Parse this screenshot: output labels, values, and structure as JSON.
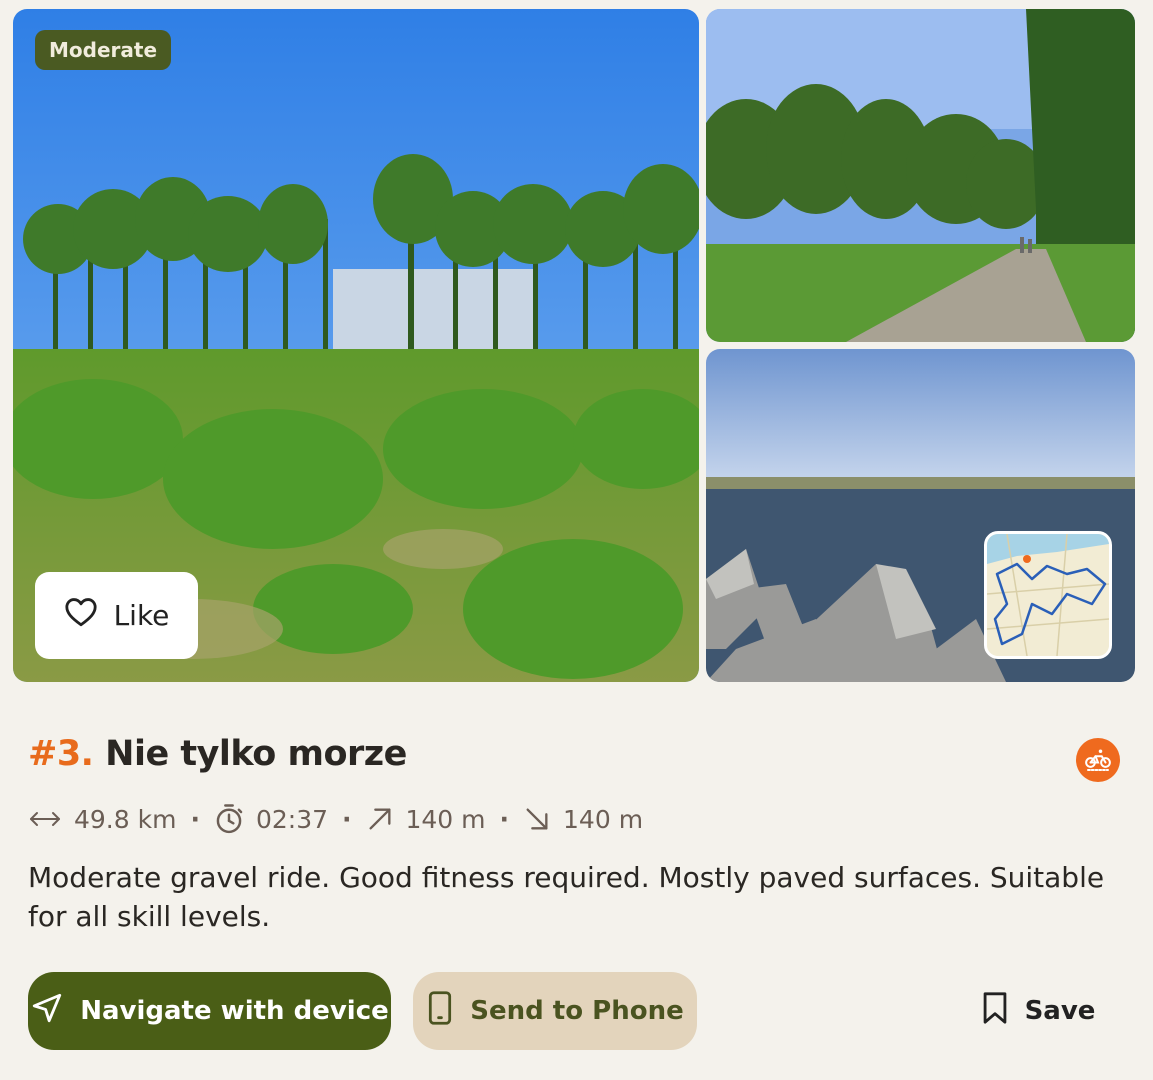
{
  "card": {
    "difficulty": "Moderate",
    "like_label": "Like",
    "rank": "#3.",
    "title": "Nie tylko morze",
    "activity_icon": "bike-icon",
    "stats": {
      "distance": "49.8 km",
      "duration": "02:37",
      "ascent": "140 m",
      "descent": "140 m",
      "separator": "·"
    },
    "description": "Moderate gravel ride. Good fitness required. Mostly paved surfaces. Suitable for all skill levels.",
    "actions": {
      "navigate_label": "Navigate with device",
      "send_label": "Send to Phone",
      "save_label": "Save"
    }
  },
  "colors": {
    "background": "#f4f2ec",
    "accent_orange": "#e86b1c",
    "primary_green": "#4a5e16",
    "secondary_tan": "#e3d4bc",
    "difficulty_badge": "#4a5a22"
  }
}
